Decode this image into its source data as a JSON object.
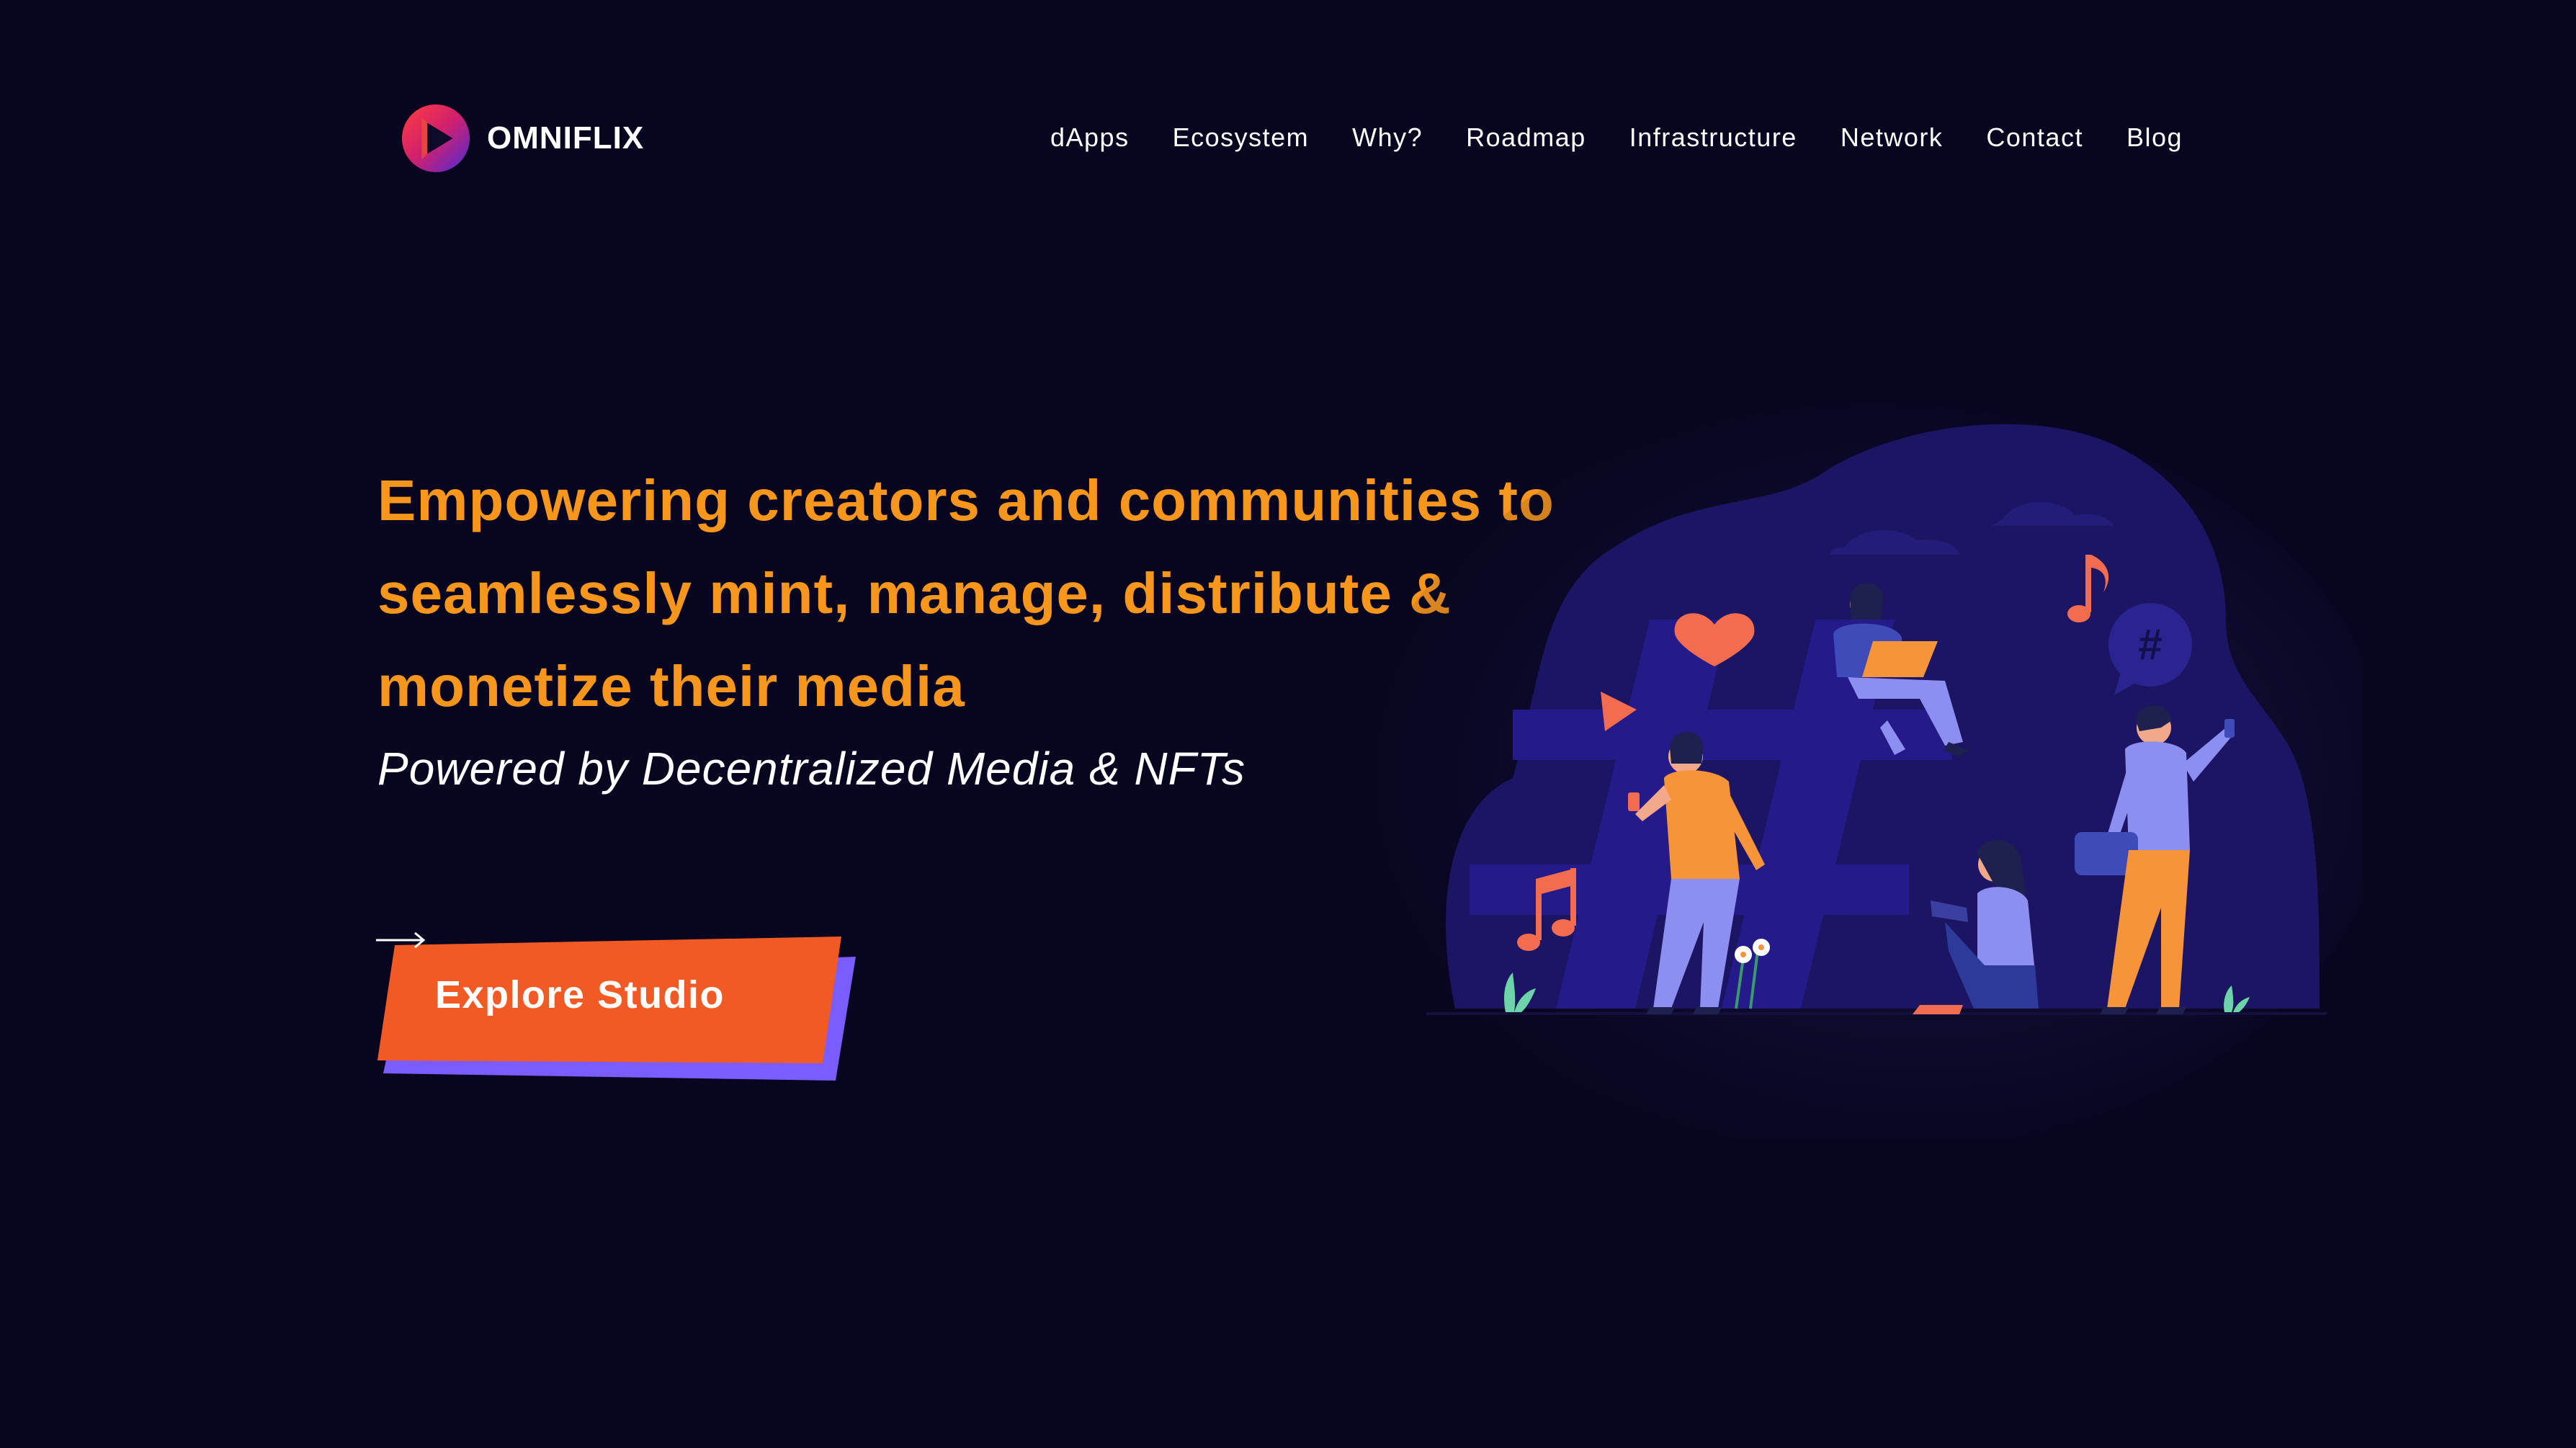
{
  "brand": {
    "name": "OMNIFLIX",
    "logo_icon": "play-triangle-icon"
  },
  "nav": {
    "items": [
      {
        "label": "dApps"
      },
      {
        "label": "Ecosystem"
      },
      {
        "label": "Why?"
      },
      {
        "label": "Roadmap"
      },
      {
        "label": "Infrastructure"
      },
      {
        "label": "Network"
      },
      {
        "label": "Contact"
      },
      {
        "label": "Blog"
      }
    ]
  },
  "hero": {
    "headline_lines": [
      "Empowering creators and communities to",
      "seamlessly mint, manage, distribute &",
      "monetize their media"
    ],
    "subhead": "Powered by Decentralized Media & NFTs",
    "cta_label": "Explore Studio",
    "cta_icon": "arrow-right-icon"
  },
  "illustration": {
    "icons": [
      "heart-icon",
      "music-note-icon",
      "play-icon",
      "hashtag-icon",
      "speech-bubble-hashtag-icon",
      "flower-icon",
      "plant-icon"
    ]
  },
  "colors": {
    "background": "#07051f",
    "headline": "#f7961d",
    "cta_primary": "#f15a24",
    "cta_shadow": "#7b5cff",
    "illustration_bg": "#1b1563"
  }
}
